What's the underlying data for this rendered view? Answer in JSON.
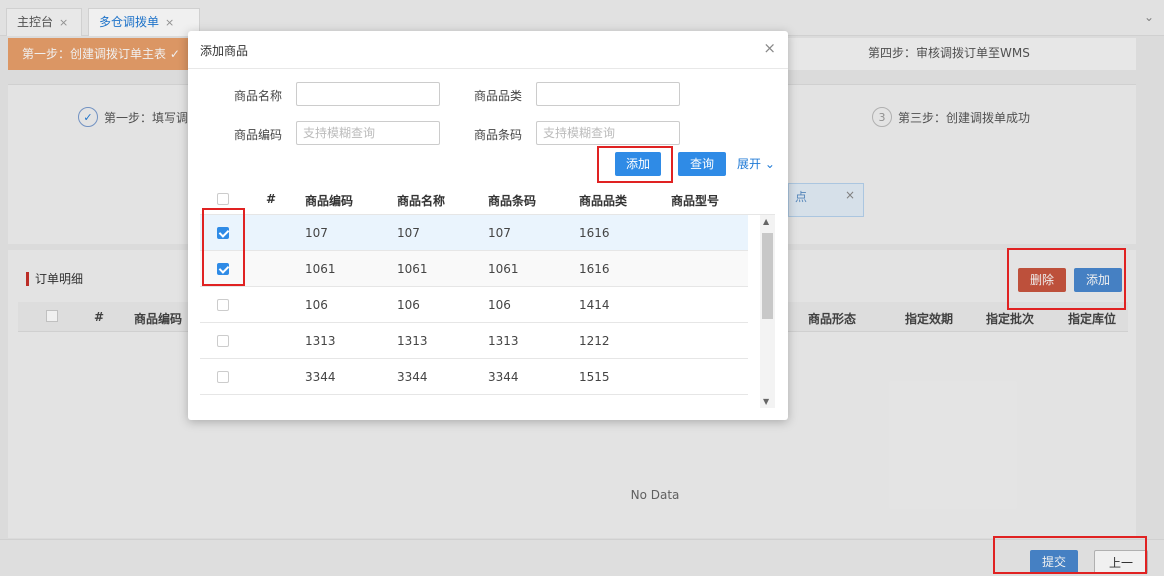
{
  "tabs": [
    {
      "label": "主控台",
      "close": "×"
    },
    {
      "label": "多仓调拨单",
      "close": "×"
    }
  ],
  "tab_arrow": "⌄",
  "steps_bar": {
    "step1": "第一步：创建调拨订单主表 ✓",
    "step4": "第四步：审核调拨订单至WMS"
  },
  "wizard": {
    "step1_num": "✓",
    "step1_label": "第一步：填写调",
    "step3_num": "3",
    "step3_label": "第三步：创建调拨单成功",
    "alert_text": "点",
    "alert_close": "×"
  },
  "detail": {
    "title": "订单明细",
    "delete_label": "删除",
    "add_label": "添加",
    "columns": [
      "#",
      "商品编码",
      "商品形态",
      "指定效期",
      "指定批次",
      "指定库位"
    ],
    "no_data": "No Data"
  },
  "footer": {
    "submit_label": "提交",
    "prev_label": "上一步"
  },
  "modal": {
    "title": "添加商品",
    "close": "×",
    "form": {
      "name_label": "商品名称",
      "name_value": "",
      "category_label": "商品品类",
      "category_value": "",
      "code_label": "商品编码",
      "code_placeholder": "支持模糊查询",
      "barcode_label": "商品条码",
      "barcode_placeholder": "支持模糊查询"
    },
    "add_label": "添加",
    "query_label": "查询",
    "expand_label": "展开 ⌄",
    "grid": {
      "columns": [
        "#",
        "商品编码",
        "商品名称",
        "商品条码",
        "商品品类",
        "商品型号"
      ],
      "rows": [
        {
          "checked": true,
          "code": "107",
          "name": "107",
          "barcode": "107",
          "category": "1616",
          "model": ""
        },
        {
          "checked": true,
          "code": "1061",
          "name": "1061",
          "barcode": "1061",
          "category": "1616",
          "model": ""
        },
        {
          "checked": false,
          "code": "106",
          "name": "106",
          "barcode": "106",
          "category": "1414",
          "model": ""
        },
        {
          "checked": false,
          "code": "1313",
          "name": "1313",
          "barcode": "1313",
          "category": "1212",
          "model": ""
        },
        {
          "checked": false,
          "code": "3344",
          "name": "3344",
          "barcode": "3344",
          "category": "1515",
          "model": ""
        }
      ]
    }
  },
  "colors": {
    "primary": "#2f8be6",
    "danger": "#c9553f",
    "step_orange": "#e9a06b",
    "annotation_red": "#e02222"
  }
}
